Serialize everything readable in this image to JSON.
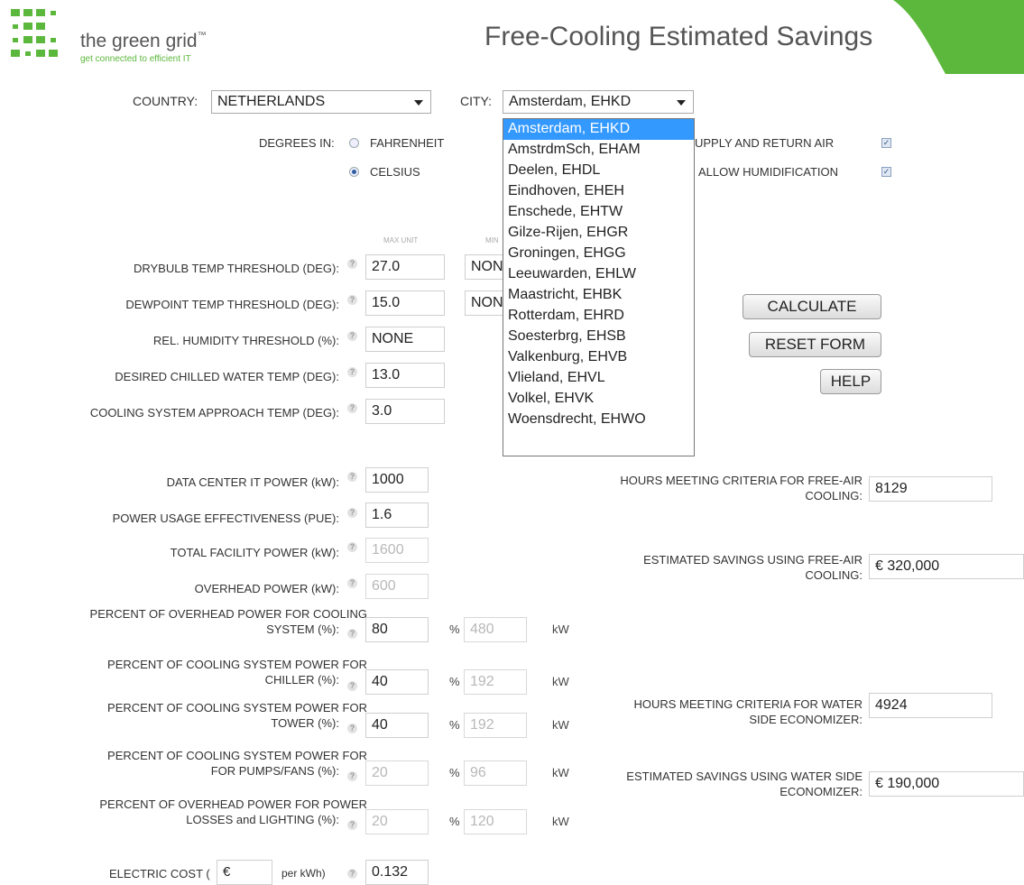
{
  "logo": {
    "name": "the green grid",
    "trademark": "™",
    "tagline": "get connected to efficient IT"
  },
  "header": {
    "title": "Free-Cooling Estimated Savings"
  },
  "location": {
    "country_label": "COUNTRY:",
    "country_value": "NETHERLANDS",
    "city_label": "CITY:",
    "city_value": "Amsterdam, EHKD",
    "city_options": [
      "Amsterdam, EHKD",
      "AmstrdmSch, EHAM",
      "Deelen, EHDL",
      "Eindhoven, EHEH",
      "Enschede, EHTW",
      "Gilze-Rijen, EHGR",
      "Groningen, EHGG",
      "Leeuwarden, EHLW",
      "Maastricht, EHBK",
      "Rotterdam, EHRD",
      "Soesterbrg, EHSB",
      "Valkenburg, EHVB",
      "Vlieland, EHVL",
      "Volkel, EHVK",
      "Woensdrecht, EHWO"
    ]
  },
  "degrees": {
    "label": "DEGREES IN:",
    "fahrenheit": "FAHRENHEIT",
    "celsius": "CELSIUS",
    "selected": "CELSIUS"
  },
  "options": {
    "supply_return": "UPPLY AND RETURN AIR",
    "humidification": "ALLOW HUMIDIFICATION"
  },
  "thresholds": {
    "max_unit_header": "MAX UNIT",
    "min_unit_header_partial": "MIN",
    "drybulb_label": "DRYBULB TEMP THRESHOLD (DEG):",
    "drybulb_value": "27.0",
    "drybulb_min": "NON",
    "dewpoint_label": "DEWPOINT TEMP THRESHOLD (DEG):",
    "dewpoint_value": "15.0",
    "dewpoint_min": "NON",
    "humidity_label": "REL. HUMIDITY THRESHOLD (%):",
    "humidity_value": "NONE",
    "chilled_label": "DESIRED CHILLED WATER TEMP (DEG):",
    "chilled_value": "13.0",
    "approach_label": "COOLING SYSTEM APPROACH TEMP (DEG):",
    "approach_value": "3.0"
  },
  "buttons": {
    "calculate": "CALCULATE",
    "reset": "RESET FORM",
    "help": "HELP"
  },
  "power": {
    "it_power_label": "DATA CENTER IT POWER (kW):",
    "it_power_value": "1000",
    "pue_label": "POWER USAGE EFFECTIVENESS (PUE):",
    "pue_value": "1.6",
    "total_label": "TOTAL FACILITY POWER (kW):",
    "total_value": "1600",
    "overhead_label": "OVERHEAD POWER (kW):",
    "overhead_value": "600",
    "cooling_label_1": "PERCENT OF OVERHEAD POWER FOR COOLING",
    "cooling_label_2": "SYSTEM (%):",
    "cooling_value": "80",
    "cooling_kw": "480",
    "chiller_label_1": "PERCENT OF COOLING SYSTEM POWER FOR",
    "chiller_label_2": "CHILLER (%):",
    "chiller_value": "40",
    "chiller_kw": "192",
    "tower_label_1": "PERCENT OF COOLING SYSTEM POWER FOR",
    "tower_label_2": "TOWER (%):",
    "tower_value": "40",
    "tower_kw": "192",
    "pumps_label_1": "PERCENT OF COOLING SYSTEM POWER FOR",
    "pumps_label_2": "FOR PUMPS/FANS (%):",
    "pumps_value": "20",
    "pumps_kw": "96",
    "losses_label_1": "PERCENT OF OVERHEAD POWER FOR POWER",
    "losses_label_2": "LOSSES and LIGHTING (%):",
    "losses_value": "20",
    "losses_kw": "120",
    "percent_sign": "%",
    "kw_unit": "kW",
    "electric_label_pre": "ELECTRIC COST (",
    "electric_currency": "€",
    "electric_label_post": "per kWh)",
    "electric_value": "0.132"
  },
  "results": {
    "hours_air_label_1": "HOURS MEETING CRITERIA FOR FREE-AIR",
    "hours_air_label_2": "COOLING:",
    "hours_air_value": "8129",
    "savings_air_label_1": "ESTIMATED SAVINGS USING FREE-AIR",
    "savings_air_label_2": "COOLING:",
    "savings_air_value": "€ 320,000",
    "hours_water_label_1": "HOURS MEETING CRITERIA FOR WATER",
    "hours_water_label_2": "SIDE ECONOMIZER:",
    "hours_water_value": "4924",
    "savings_water_label_1": "ESTIMATED SAVINGS USING WATER SIDE",
    "savings_water_label_2": "ECONOMIZER:",
    "savings_water_value": "€ 190,000"
  },
  "colors": {
    "brand_green": "#5cb83c",
    "selection_blue": "#3399ff"
  }
}
